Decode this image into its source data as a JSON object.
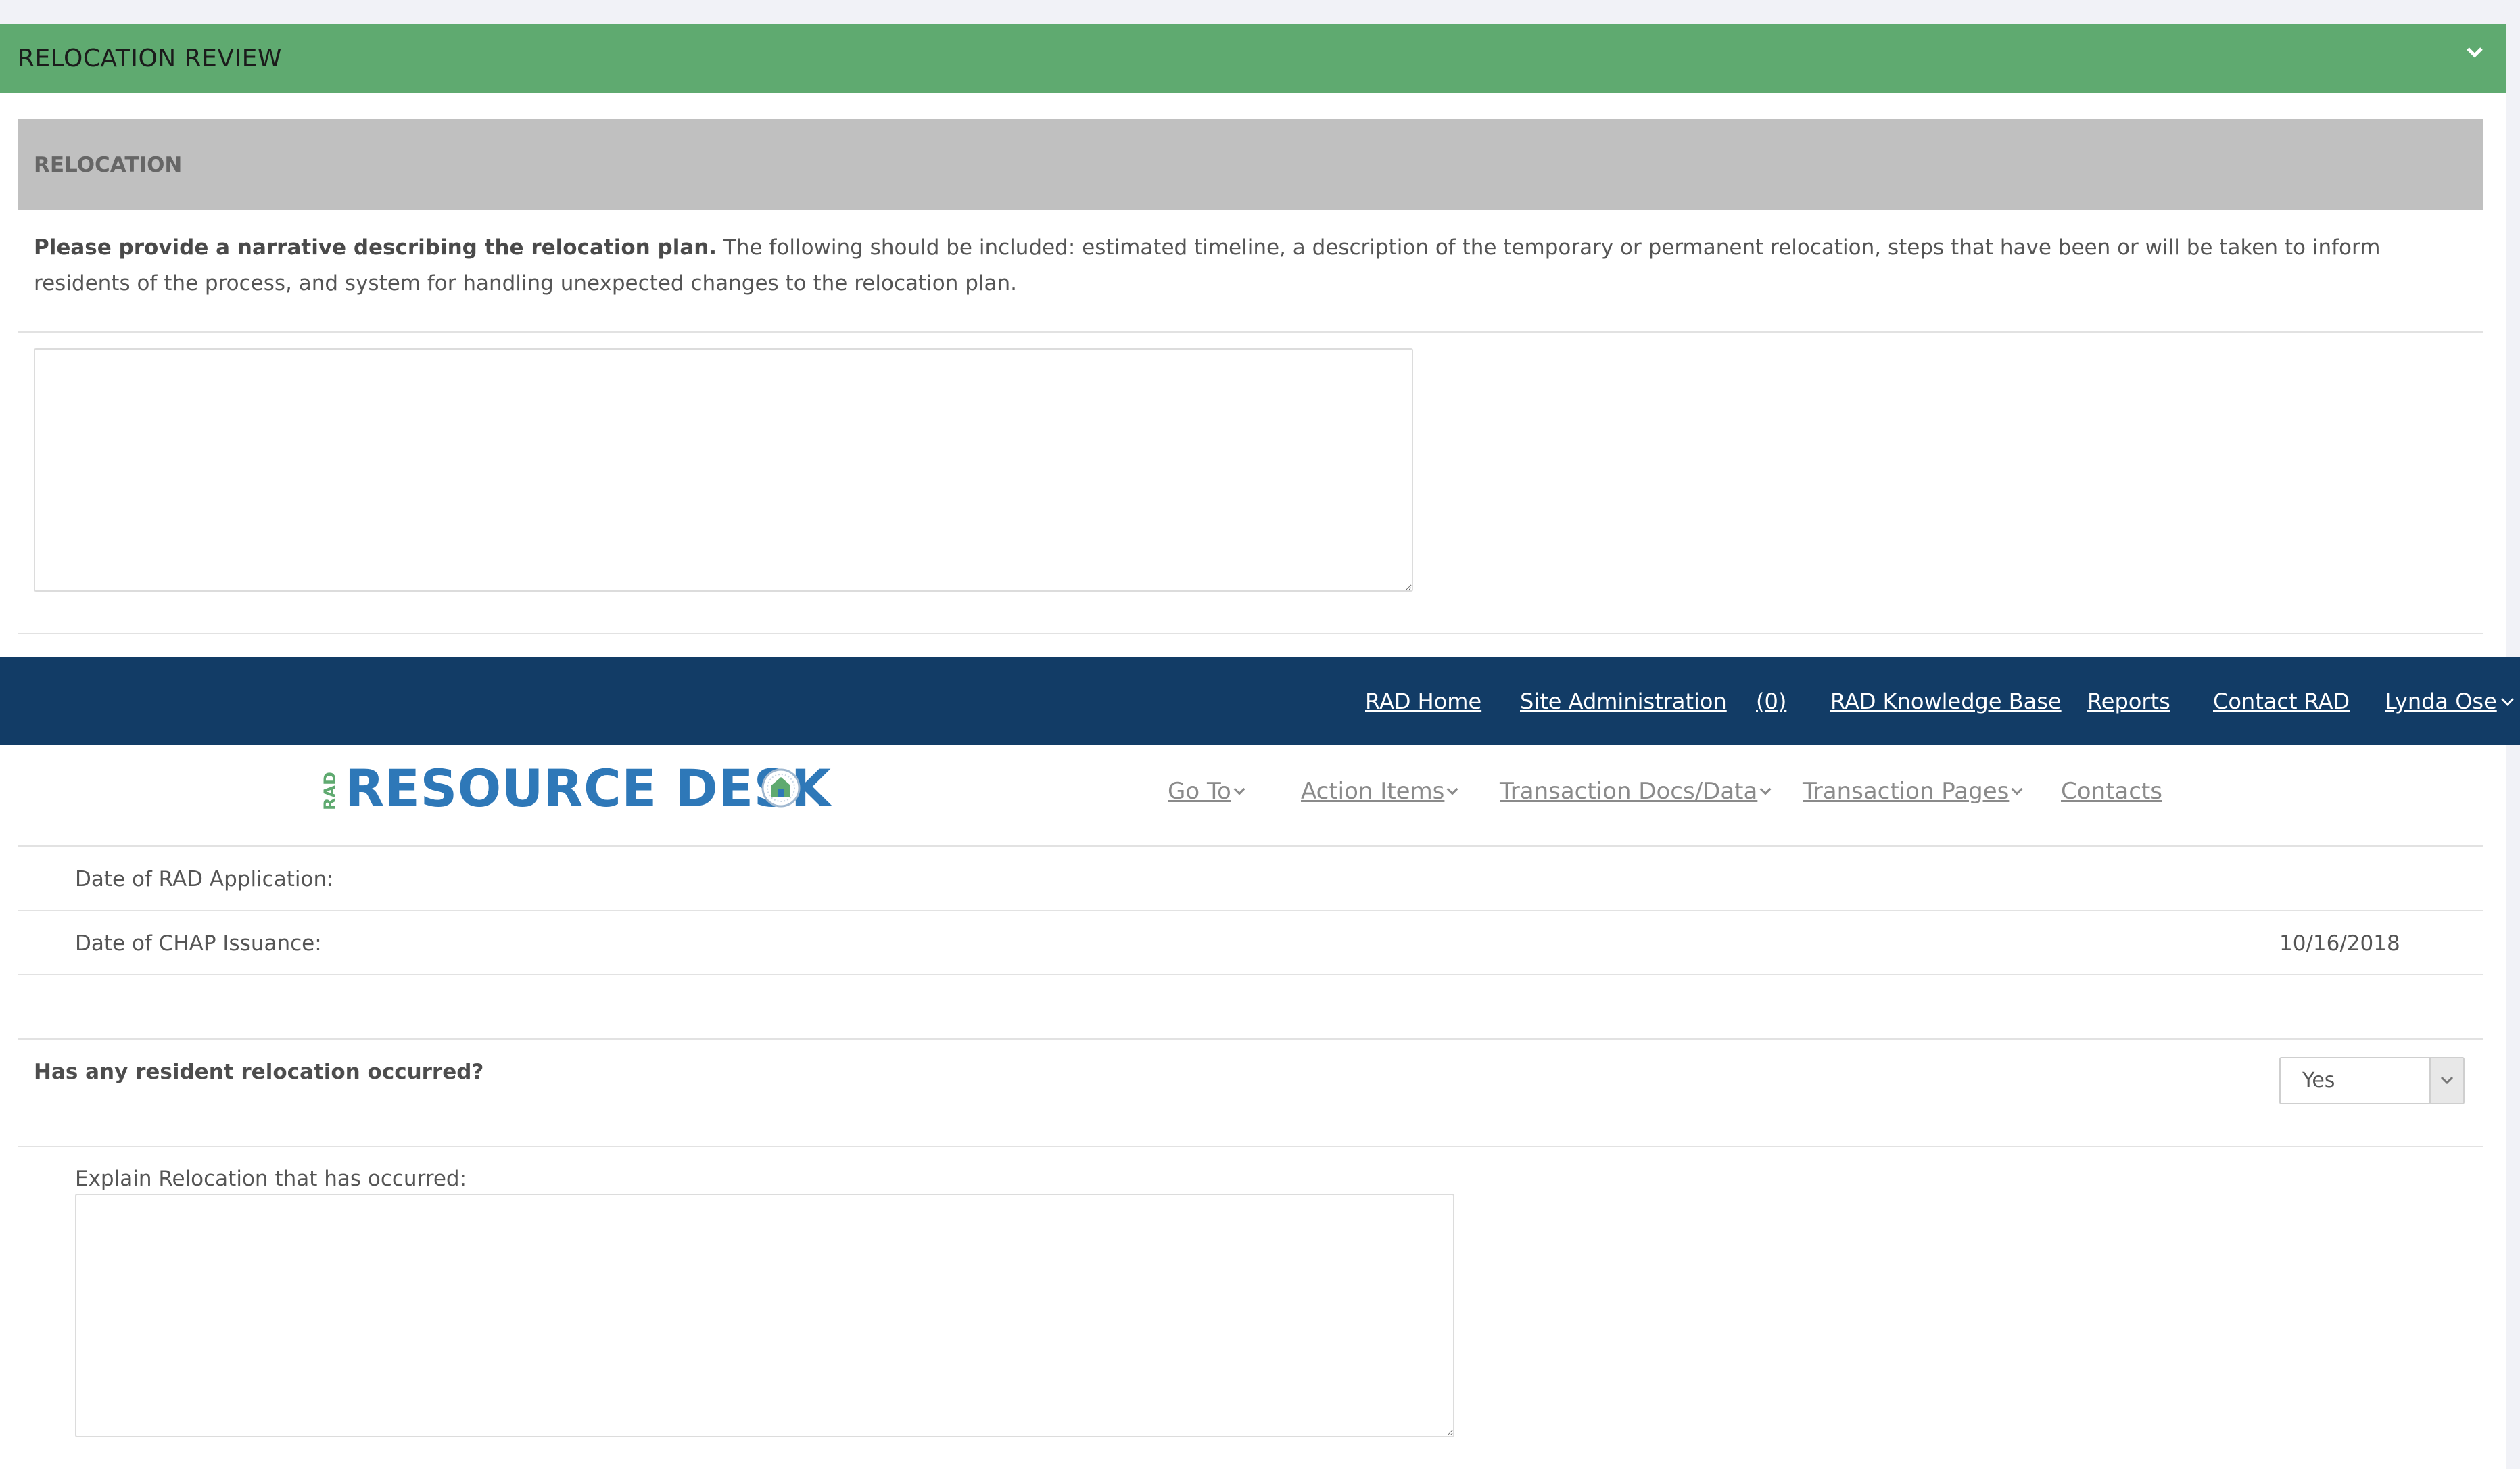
{
  "review": {
    "title": "RELOCATION REVIEW",
    "section_title": "RELOCATION",
    "narrative_bold": "Please provide a narrative describing the relocation plan.",
    "narrative_rest": " The following should be included: estimated timeline, a description of the temporary or permanent relocation, steps that have been or will be taken to inform residents of the process, and system for handling unexpected changes to the relocation plan.",
    "narrative_value": ""
  },
  "navbar": {
    "home": "RAD Home",
    "admin": "Site Administration",
    "count": "(0)",
    "knowledge_base": "RAD Knowledge Base",
    "reports": "Reports",
    "contact": "Contact RAD",
    "user": "Lynda Ose"
  },
  "logo": {
    "prefix": "RAD",
    "text": "RESOURCE DESK"
  },
  "subnav": {
    "goto": "Go To",
    "action_items": "Action Items",
    "docs": "Transaction Docs/Data",
    "pages": "Transaction Pages",
    "contacts": "Contacts"
  },
  "details": {
    "app_label": "Date of RAD Application:",
    "app_value": "",
    "chap_label": "Date of CHAP Issuance:",
    "chap_value": "10/16/2018",
    "question": "Has any resident relocation occurred?",
    "answer": "Yes",
    "explain_label": "Explain Relocation that has occurred:",
    "explain_value": ""
  },
  "colors": {
    "header_green": "#5faa70",
    "navbar_blue": "#123c66",
    "logo_blue": "#2e78b8",
    "logo_green": "#5faa70"
  }
}
